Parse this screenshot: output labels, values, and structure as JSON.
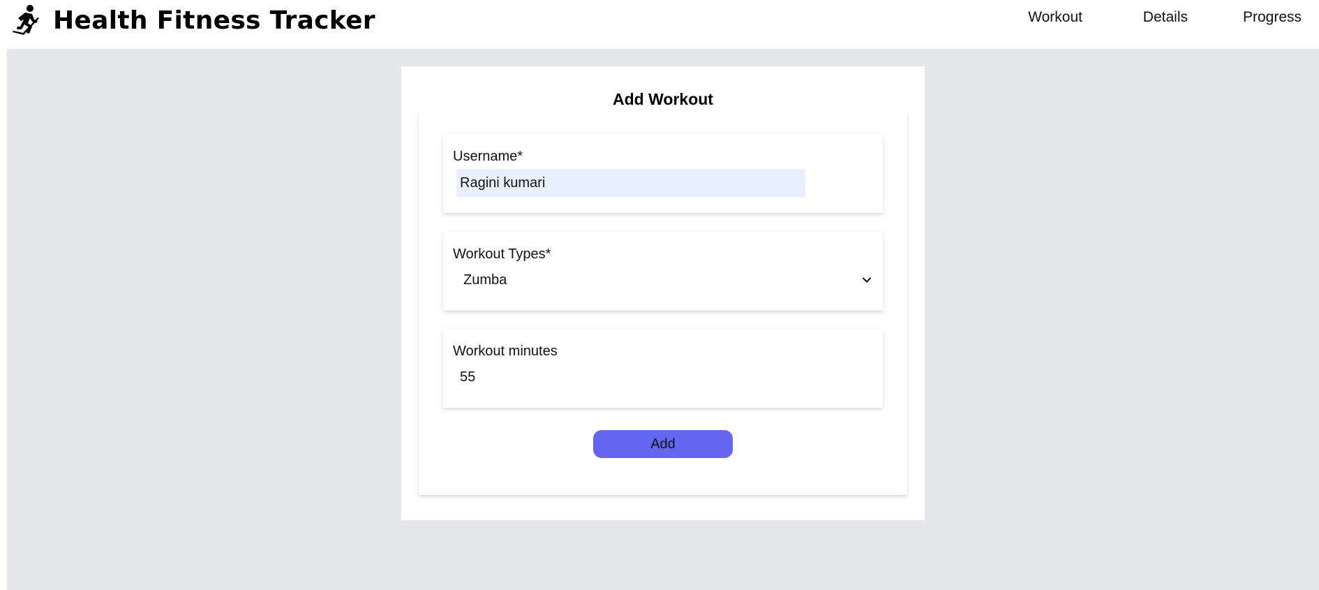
{
  "app": {
    "title": "Health Fitness Tracker",
    "logo_icon": "runner-icon"
  },
  "nav": {
    "items": [
      {
        "label": "Workout"
      },
      {
        "label": "Details"
      },
      {
        "label": "Progress"
      }
    ]
  },
  "form": {
    "heading": "Add Workout",
    "username": {
      "label": "Username*",
      "value": "Ragini kumari"
    },
    "workout_type": {
      "label": "Workout Types*",
      "selected": "Zumba",
      "icon": "chevron-down-icon"
    },
    "minutes": {
      "label": "Workout minutes",
      "value": "55"
    },
    "submit_label": "Add"
  },
  "colors": {
    "page_bg": "#e5e7eb",
    "autofill_bg": "#e8f0fe",
    "button_bg": "#6366f1"
  }
}
